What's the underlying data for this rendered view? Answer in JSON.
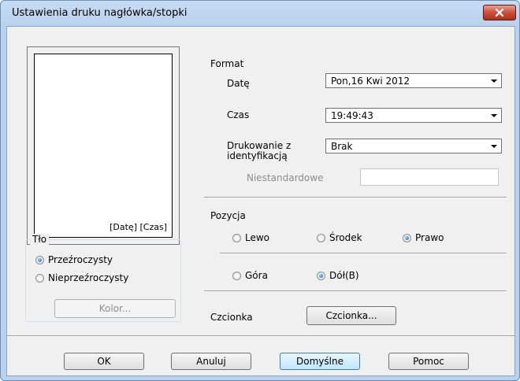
{
  "window": {
    "title": "Ustawienia druku nagłówka/stopki"
  },
  "preview": {
    "text": "[Datę] [Czas]"
  },
  "background": {
    "label": "Tło",
    "options": [
      {
        "label": "Przeźroczysty",
        "selected": true
      },
      {
        "label": "Nieprzeźroczysty",
        "selected": false
      }
    ],
    "color_button": "Kolor..."
  },
  "format": {
    "label": "Format",
    "date_label": "Datę",
    "date_value": "Pon,16 Kwi 2012",
    "time_label": "Czas",
    "time_value": "19:49:43",
    "id_print_label_line1": "Drukowanie z",
    "id_print_label_line2": "identyfikacją",
    "id_print_value": "Brak",
    "custom_label": "Niestandardowe",
    "custom_value": ""
  },
  "position": {
    "label": "Pozycja",
    "horizontal": [
      {
        "label": "Lewo",
        "selected": false
      },
      {
        "label": "Środek",
        "selected": false
      },
      {
        "label": "Prawo",
        "selected": true
      }
    ],
    "vertical": [
      {
        "label": "Góra",
        "selected": false
      },
      {
        "label": "Dół(B)",
        "selected": true
      }
    ]
  },
  "font": {
    "label": "Czcionka",
    "button": "Czcionka..."
  },
  "buttons": {
    "ok": "OK",
    "cancel": "Anuluj",
    "defaults": "Domyślne",
    "help": "Pomoc"
  }
}
